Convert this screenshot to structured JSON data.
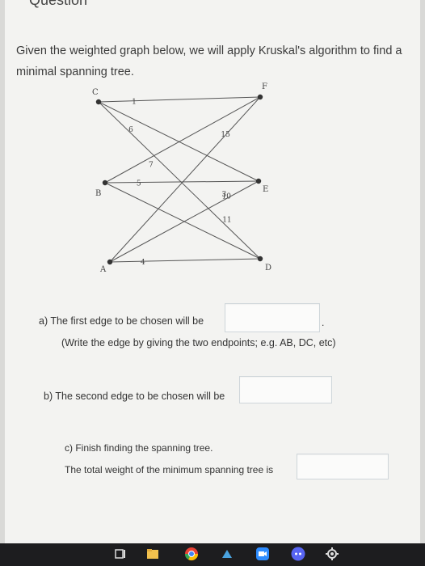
{
  "header": {
    "partial_title": "Question"
  },
  "prompt": {
    "text": "Given the weighted graph below, we will apply Kruskal's algorithm to find a minimal spanning tree."
  },
  "graph": {
    "nodes": [
      {
        "id": "C",
        "label": "C"
      },
      {
        "id": "F",
        "label": "F"
      },
      {
        "id": "B",
        "label": "B"
      },
      {
        "id": "E",
        "label": "E"
      },
      {
        "id": "A",
        "label": "A"
      },
      {
        "id": "D",
        "label": "D"
      }
    ],
    "edges": [
      {
        "from": "C",
        "to": "F",
        "weight": "1"
      },
      {
        "from": "C",
        "to": "D",
        "weight": "6"
      },
      {
        "from": "B",
        "to": "E",
        "weight": "5"
      },
      {
        "from": "A",
        "to": "D",
        "weight": "4"
      },
      {
        "from": "A",
        "to": "F",
        "weight": "15"
      },
      {
        "from": "B",
        "to": "D",
        "weight": "11"
      },
      {
        "from": "A",
        "to": "E",
        "weight": "3"
      },
      {
        "from": "B",
        "to": "F",
        "weight": "7"
      },
      {
        "from": "C",
        "to": "E",
        "weight": "10"
      }
    ]
  },
  "questions": {
    "a_label": "a)  The first edge to be chosen will be",
    "a_trailing": ".",
    "a_note": "(Write the edge by giving the two endpoints; e.g. AB, DC, etc)",
    "a_value": "",
    "b_label": "b)  The second edge to be chosen will be",
    "b_value": "",
    "c_label": "c)  Finish finding the spanning tree.",
    "c_total_label": "The total weight of the minimum spanning tree is",
    "c_value": ""
  },
  "taskbar": {
    "icons": [
      "task-view-icon",
      "file-explorer-icon",
      "chrome-icon",
      "app-icon",
      "zoom-icon",
      "discord-icon",
      "settings-icon"
    ]
  },
  "colors": {
    "node": "#333333",
    "edge": "#555555",
    "page": "#f3f3f1"
  }
}
